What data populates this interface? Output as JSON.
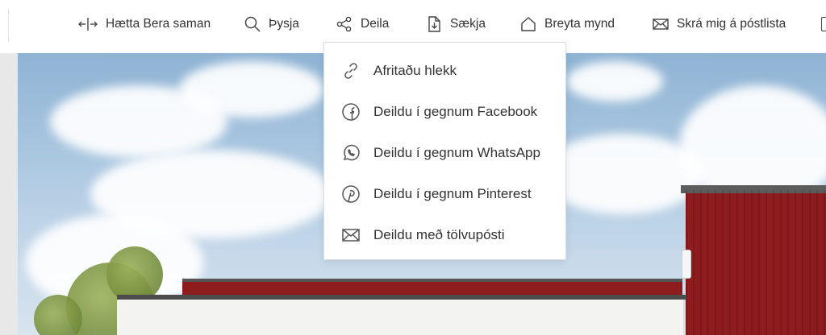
{
  "toolbar": {
    "compare_label": "Hætta Bera saman",
    "search_label": "Þysja",
    "share_label": "Deila",
    "download_label": "Sækja",
    "edit_label": "Breyta mynd",
    "newsletter_label": "Skrá mig á póstlista"
  },
  "share_menu": {
    "items": [
      {
        "label": "Afritaðu hlekk",
        "icon": "link-icon"
      },
      {
        "label": "Deildu í gegnum Facebook",
        "icon": "facebook-icon"
      },
      {
        "label": "Deildu í gegnum WhatsApp",
        "icon": "whatsapp-icon"
      },
      {
        "label": "Deildu í gegnum Pinterest",
        "icon": "pinterest-icon"
      },
      {
        "label": "Deildu með tölvupósti",
        "icon": "mail-icon"
      }
    ]
  },
  "colors": {
    "text": "#333333",
    "menu_border": "#dcdcdc",
    "building_red": "#8e1b1e",
    "sky": "#a9c6e0"
  }
}
